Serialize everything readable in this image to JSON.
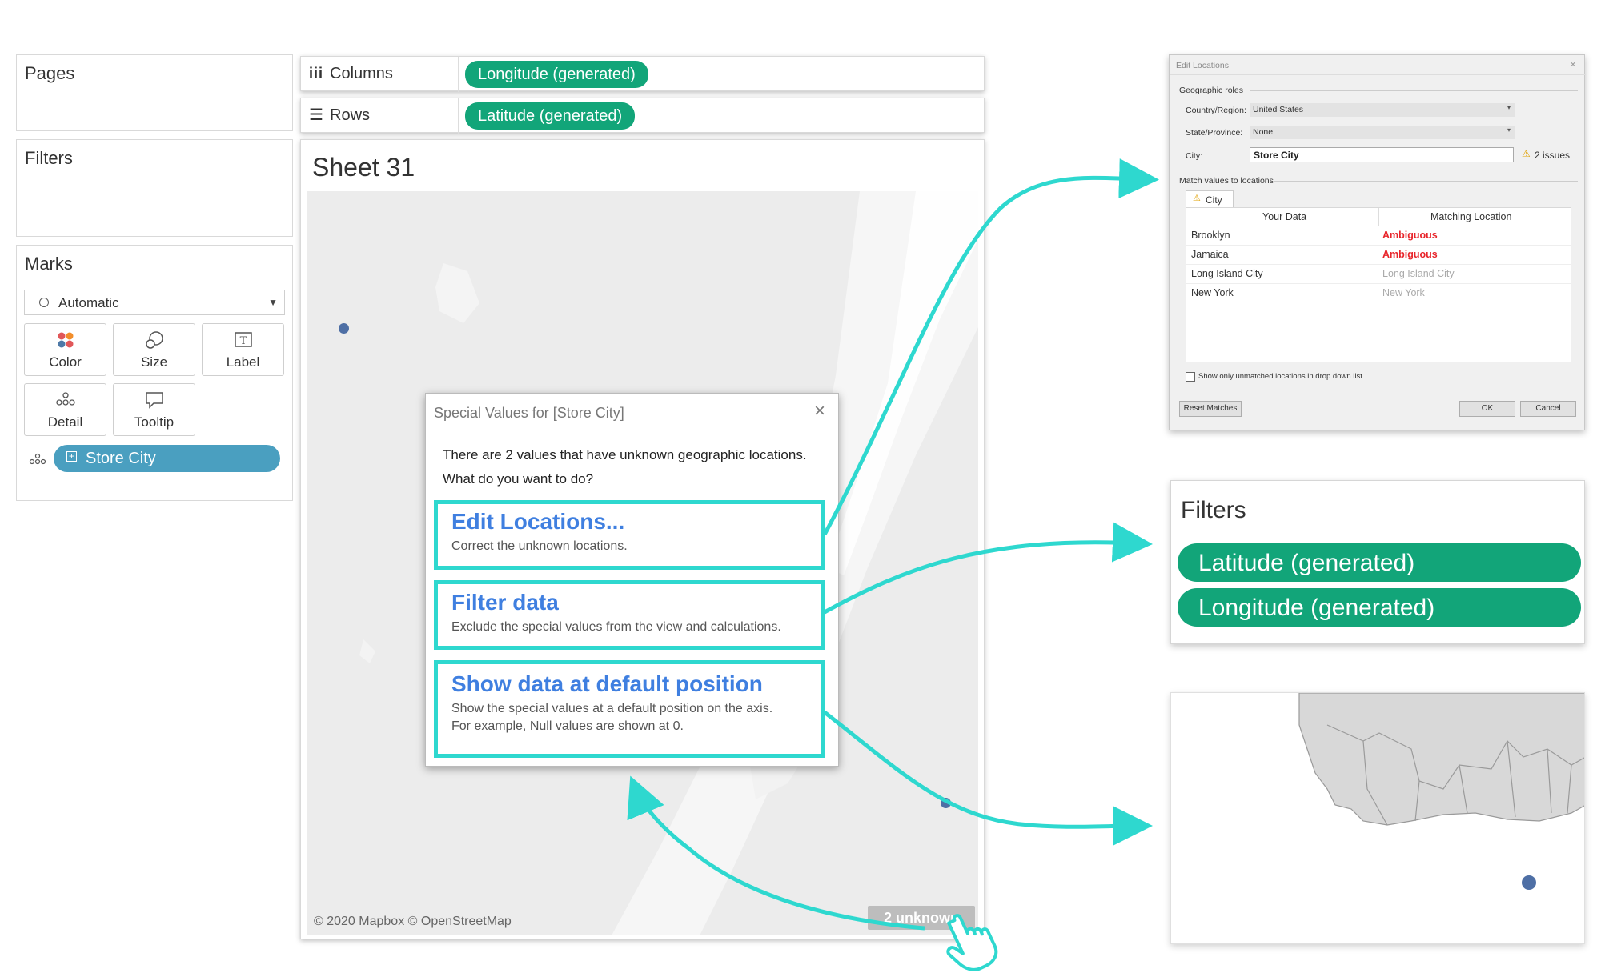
{
  "shelves": {
    "columns_label": "Columns",
    "columns_pill": "Longitude (generated)",
    "rows_label": "Rows",
    "rows_pill": "Latitude (generated)"
  },
  "left": {
    "pages": "Pages",
    "filters": "Filters",
    "marks": "Marks",
    "mark_type": "Automatic",
    "cards": {
      "color": "Color",
      "size": "Size",
      "label": "Label",
      "detail": "Detail",
      "tooltip": "Tooltip"
    },
    "mark_pill": "Store City"
  },
  "sheet": {
    "title": "Sheet 31",
    "attribution": "© 2020 Mapbox © OpenStreetMap",
    "indicator": "2 unknown"
  },
  "dialog": {
    "title": "Special Values for [Store City]",
    "line1": "There are 2 values that have unknown geographic locations.",
    "line2": "What do you want to do?",
    "options": [
      {
        "title": "Edit Locations...",
        "desc": "Correct the unknown locations."
      },
      {
        "title": "Filter data",
        "desc": "Exclude the special values from the view and calculations."
      },
      {
        "title": "Show data at default position",
        "desc": "Show the special values at a default position on the axis.",
        "desc2": "For example, Null values are shown at 0."
      }
    ]
  },
  "edit_locations": {
    "title": "Edit Locations",
    "geo_roles": "Geographic roles",
    "country_label": "Country/Region:",
    "country_value": "United States",
    "state_label": "State/Province:",
    "state_value": "None",
    "city_label": "City:",
    "city_value": "Store City",
    "issues": "2 issues",
    "match_label": "Match values to locations",
    "tab": "City",
    "col_your_data": "Your Data",
    "col_matching": "Matching Location",
    "rows": [
      {
        "data": "Brooklyn",
        "match": "Ambiguous",
        "status": "ambiguous"
      },
      {
        "data": "Jamaica",
        "match": "Ambiguous",
        "status": "ambiguous"
      },
      {
        "data": "Long Island City",
        "match": "Long Island City",
        "status": "matched"
      },
      {
        "data": "New York",
        "match": "New York",
        "status": "matched"
      }
    ],
    "checkbox_label": "Show only unmatched locations in drop down list",
    "reset_button": "Reset Matches",
    "ok_button": "OK",
    "cancel_button": "Cancel"
  },
  "filters_callout": {
    "title": "Filters",
    "pills": [
      "Latitude (generated)",
      "Longitude (generated)"
    ]
  },
  "colors": {
    "teal_pill": "#12a579",
    "blue_pill": "#4a9fc0",
    "link_blue": "#3f7fe0",
    "highlight": "#2ed8cf",
    "ambiguous": "#e8252b",
    "map_bg": "#ececec",
    "data_point": "#4e6fa5"
  }
}
